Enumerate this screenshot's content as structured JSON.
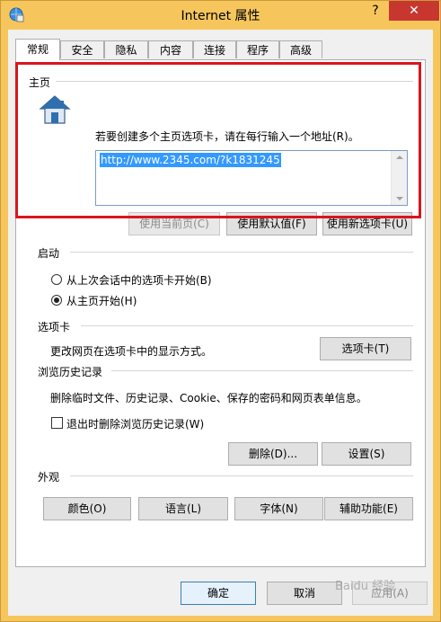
{
  "window": {
    "title": "Internet 属性",
    "help": "?",
    "close": "✕"
  },
  "tabs": [
    "常规",
    "安全",
    "隐私",
    "内容",
    "连接",
    "程序",
    "高级"
  ],
  "home": {
    "title": "主页",
    "instruction": "若要创建多个主页选项卡，请在每行输入一个地址(R)。",
    "url": "http://www.2345.com/?k1831245",
    "btn_current": "使用当前页(C)",
    "btn_default": "使用默认值(F)",
    "btn_newtab": "使用新选项卡(U)"
  },
  "startup": {
    "title": "启动",
    "option_last": "从上次会话中的选项卡开始(B)",
    "option_home": "从主页开始(H)",
    "selected": "home"
  },
  "tabsec": {
    "title": "选项卡",
    "desc": "更改网页在选项卡中的显示方式。",
    "btn": "选项卡(T)"
  },
  "history": {
    "title": "浏览历史记录",
    "desc": "删除临时文件、历史记录、Cookie、保存的密码和网页表单信息。",
    "checkbox": "退出时删除浏览历史记录(W)",
    "btn_delete": "删除(D)...",
    "btn_settings": "设置(S)"
  },
  "appearance": {
    "title": "外观",
    "btn_colors": "颜色(O)",
    "btn_languages": "语言(L)",
    "btn_fonts": "字体(N)",
    "btn_accessibility": "辅助功能(E)"
  },
  "footer": {
    "ok": "确定",
    "cancel": "取消",
    "apply": "应用(A)"
  },
  "watermark": "Baidu 经验",
  "colors": {
    "accent": "#3399ff",
    "highlight_frame": "#d9161b",
    "title_bar": "#f6c65d",
    "close": "#c7372f"
  }
}
